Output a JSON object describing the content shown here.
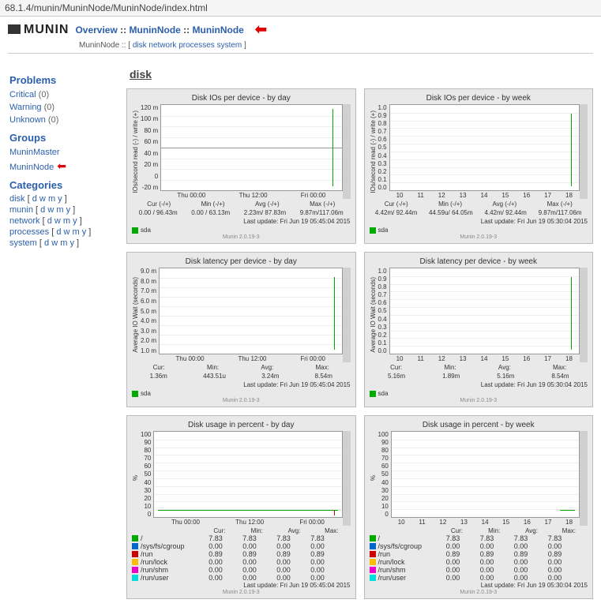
{
  "address_bar": "68.1.4/munin/MuninNode/MuninNode/index.html",
  "breadcrumb": {
    "overview": "Overview",
    "sep": "::",
    "node1": "MuninNode",
    "node2": "MuninNode"
  },
  "sub": {
    "prefix": "MuninNode ::",
    "links": [
      "disk",
      "network",
      "processes",
      "system"
    ]
  },
  "sidebar": {
    "problems_h": "Problems",
    "problems": [
      {
        "label": "Critical",
        "count": "(0)"
      },
      {
        "label": "Warning",
        "count": "(0)"
      },
      {
        "label": "Unknown",
        "count": "(0)"
      }
    ],
    "groups_h": "Groups",
    "groups": [
      "MuninMaster",
      "MuninNode"
    ],
    "categories_h": "Categories",
    "categories": [
      "disk",
      "munin",
      "network",
      "processes",
      "system"
    ],
    "period": [
      "d",
      "w",
      "m",
      "y"
    ]
  },
  "section_title": "disk",
  "charts": [
    {
      "title": "Disk IOs per device - by day",
      "ylabel": "IOs/second read (-) / write (+)",
      "yticks": [
        "120 m",
        "100 m",
        "80 m",
        "60 m",
        "40 m",
        "20 m",
        "0",
        "-20 m"
      ],
      "xticks": [
        "Thu 00:00",
        "Thu 12:00",
        "Fri 00:00"
      ],
      "stat_h": [
        "Cur (-/+)",
        "Min (-/+)",
        "Avg (-/+)",
        "Max (-/+)"
      ],
      "stat_v": [
        "0.00 / 96.43m",
        "0.00 / 63.13m",
        "2.23m/ 87.83m",
        "9.87m/117.06m"
      ],
      "update": "Last update: Fri Jun 19 05:45:04 2015",
      "legend": [
        {
          "color": "#00aa00",
          "label": "sda"
        }
      ],
      "footer": "Munin 2.0.19-3",
      "type": "spike-center"
    },
    {
      "title": "Disk IOs per device - by week",
      "ylabel": "IOs/second read (-) / write (+)",
      "yticks": [
        "1.0",
        "0.9",
        "0.8",
        "0.7",
        "0.6",
        "0.5",
        "0.4",
        "0.3",
        "0.2",
        "0.1",
        "0.0"
      ],
      "xticks": [
        "10",
        "11",
        "12",
        "13",
        "14",
        "15",
        "16",
        "17",
        "18"
      ],
      "stat_h": [
        "Cur (-/+)",
        "Min (-/+)",
        "Avg (-/+)",
        "Max (-/+)"
      ],
      "stat_v": [
        "4.42m/ 92.44m",
        "44.59u/ 64.05m",
        "4.42m/ 92.44m",
        "9.87m/117.06m"
      ],
      "update": "Last update: Fri Jun 19 05:30:04 2015",
      "legend": [
        {
          "color": "#00aa00",
          "label": "sda"
        }
      ],
      "footer": "Munin 2.0.19-3",
      "type": "spike-right"
    },
    {
      "title": "Disk latency per device - by day",
      "ylabel": "Average IO Wait (seconds)",
      "yticks": [
        "9.0 m",
        "8.0 m",
        "7.0 m",
        "6.0 m",
        "5.0 m",
        "4.0 m",
        "3.0 m",
        "2.0 m",
        "1.0 m"
      ],
      "xticks": [
        "Thu 00:00",
        "Thu 12:00",
        "Fri 00:00"
      ],
      "stat_h": [
        "Cur:",
        "Min:",
        "Avg:",
        "Max:"
      ],
      "stat_v": [
        "1.36m",
        "443.51u",
        "3.24m",
        "8.54m"
      ],
      "update": "Last update: Fri Jun 19 05:45:04 2015",
      "legend": [
        {
          "color": "#00aa00",
          "label": "sda"
        }
      ],
      "footer": "Munin 2.0.19-3",
      "type": "spike-right"
    },
    {
      "title": "Disk latency per device - by week",
      "ylabel": "Average IO Wait (seconds)",
      "yticks": [
        "1.0",
        "0.9",
        "0.8",
        "0.7",
        "0.6",
        "0.5",
        "0.4",
        "0.3",
        "0.2",
        "0.1",
        "0.0"
      ],
      "xticks": [
        "10",
        "11",
        "12",
        "13",
        "14",
        "15",
        "16",
        "17",
        "18"
      ],
      "stat_h": [
        "Cur:",
        "Min:",
        "Avg:",
        "Max:"
      ],
      "stat_v": [
        "5.16m",
        "1.89m",
        "5.16m",
        "8.54m"
      ],
      "update": "Last update: Fri Jun 19 05:30:04 2015",
      "legend": [
        {
          "color": "#00aa00",
          "label": "sda"
        }
      ],
      "footer": "Munin 2.0.19-3",
      "type": "spike-right"
    },
    {
      "title": "Disk usage in percent - by day",
      "ylabel": "%",
      "yticks": [
        "100",
        "90",
        "80",
        "70",
        "60",
        "50",
        "40",
        "30",
        "20",
        "10",
        "0"
      ],
      "xticks": [
        "Thu 00:00",
        "Thu 12:00",
        "Fri 00:00"
      ],
      "stat_h": [
        "Cur:",
        "Min:",
        "Avg:",
        "Max:"
      ],
      "legend_table": [
        {
          "color": "#00aa00",
          "label": "/",
          "v": [
            "7.83",
            "7.83",
            "7.83",
            "7.83"
          ]
        },
        {
          "color": "#0066cc",
          "label": "/sys/fs/cgroup",
          "v": [
            "0.00",
            "0.00",
            "0.00",
            "0.00"
          ]
        },
        {
          "color": "#cc0000",
          "label": "/run",
          "v": [
            "0.89",
            "0.89",
            "0.89",
            "0.89"
          ]
        },
        {
          "color": "#ffbb00",
          "label": "/run/lock",
          "v": [
            "0.00",
            "0.00",
            "0.00",
            "0.00"
          ]
        },
        {
          "color": "#ee00cc",
          "label": "/run/shm",
          "v": [
            "0.00",
            "0.00",
            "0.00",
            "0.00"
          ]
        },
        {
          "color": "#00dddd",
          "label": "/run/user",
          "v": [
            "0.00",
            "0.00",
            "0.00",
            "0.00"
          ]
        }
      ],
      "update": "Last update: Fri Jun 19 05:45:04 2015",
      "footer": "Munin 2.0.19-3",
      "type": "flat"
    },
    {
      "title": "Disk usage in percent - by week",
      "ylabel": "%",
      "yticks": [
        "100",
        "90",
        "80",
        "70",
        "60",
        "50",
        "40",
        "30",
        "20",
        "10",
        "0"
      ],
      "xticks": [
        "10",
        "11",
        "12",
        "13",
        "14",
        "15",
        "16",
        "17",
        "18"
      ],
      "stat_h": [
        "Cur:",
        "Min:",
        "Avg:",
        "Max:"
      ],
      "legend_table": [
        {
          "color": "#00aa00",
          "label": "/",
          "v": [
            "7.83",
            "7.83",
            "7.83",
            "7.83"
          ]
        },
        {
          "color": "#0066cc",
          "label": "/sys/fs/cgroup",
          "v": [
            "0.00",
            "0.00",
            "0.00",
            "0.00"
          ]
        },
        {
          "color": "#cc0000",
          "label": "/run",
          "v": [
            "0.89",
            "0.89",
            "0.89",
            "0.89"
          ]
        },
        {
          "color": "#ffbb00",
          "label": "/run/lock",
          "v": [
            "0.00",
            "0.00",
            "0.00",
            "0.00"
          ]
        },
        {
          "color": "#ee00cc",
          "label": "/run/shm",
          "v": [
            "0.00",
            "0.00",
            "0.00",
            "0.00"
          ]
        },
        {
          "color": "#00dddd",
          "label": "/run/user",
          "v": [
            "0.00",
            "0.00",
            "0.00",
            "0.00"
          ]
        }
      ],
      "update": "Last update: Fri Jun 19 05:30:04 2015",
      "footer": "Munin 2.0.19-3",
      "type": "flat-short"
    }
  ],
  "chart_data": [
    {
      "type": "line",
      "title": "Disk IOs per device - by day",
      "series": [
        {
          "name": "sda",
          "values": []
        }
      ],
      "ylim": [
        -20,
        120
      ],
      "ylabel": "IOs/second read (-) / write (+)",
      "xticks": [
        "Thu 00:00",
        "Thu 12:00",
        "Fri 00:00"
      ]
    },
    {
      "type": "line",
      "title": "Disk IOs per device - by week",
      "series": [
        {
          "name": "sda",
          "values": []
        }
      ],
      "ylim": [
        0,
        1
      ],
      "ylabel": "IOs/second read (-) / write (+)",
      "xticks": [
        "10",
        "11",
        "12",
        "13",
        "14",
        "15",
        "16",
        "17",
        "18"
      ]
    },
    {
      "type": "line",
      "title": "Disk latency per device - by day",
      "series": [
        {
          "name": "sda",
          "values": []
        }
      ],
      "ylim": [
        0,
        9
      ],
      "ylabel": "Average IO Wait (seconds)",
      "xticks": [
        "Thu 00:00",
        "Thu 12:00",
        "Fri 00:00"
      ]
    },
    {
      "type": "line",
      "title": "Disk latency per device - by week",
      "series": [
        {
          "name": "sda",
          "values": []
        }
      ],
      "ylim": [
        0,
        1
      ],
      "ylabel": "Average IO Wait (seconds)",
      "xticks": [
        "10",
        "11",
        "12",
        "13",
        "14",
        "15",
        "16",
        "17",
        "18"
      ]
    },
    {
      "type": "line",
      "title": "Disk usage in percent - by day",
      "ylim": [
        0,
        100
      ],
      "ylabel": "%",
      "xticks": [
        "Thu 00:00",
        "Thu 12:00",
        "Fri 00:00"
      ],
      "series": [
        {
          "name": "/",
          "values": [
            7.83
          ]
        },
        {
          "name": "/sys/fs/cgroup",
          "values": [
            0
          ]
        },
        {
          "name": "/run",
          "values": [
            0.89
          ]
        },
        {
          "name": "/run/lock",
          "values": [
            0
          ]
        },
        {
          "name": "/run/shm",
          "values": [
            0
          ]
        },
        {
          "name": "/run/user",
          "values": [
            0
          ]
        }
      ]
    },
    {
      "type": "line",
      "title": "Disk usage in percent - by week",
      "ylim": [
        0,
        100
      ],
      "ylabel": "%",
      "xticks": [
        "10",
        "11",
        "12",
        "13",
        "14",
        "15",
        "16",
        "17",
        "18"
      ],
      "series": [
        {
          "name": "/",
          "values": [
            7.83
          ]
        },
        {
          "name": "/sys/fs/cgroup",
          "values": [
            0
          ]
        },
        {
          "name": "/run",
          "values": [
            0.89
          ]
        },
        {
          "name": "/run/lock",
          "values": [
            0
          ]
        },
        {
          "name": "/run/shm",
          "values": [
            0
          ]
        },
        {
          "name": "/run/user",
          "values": [
            0
          ]
        }
      ]
    }
  ]
}
